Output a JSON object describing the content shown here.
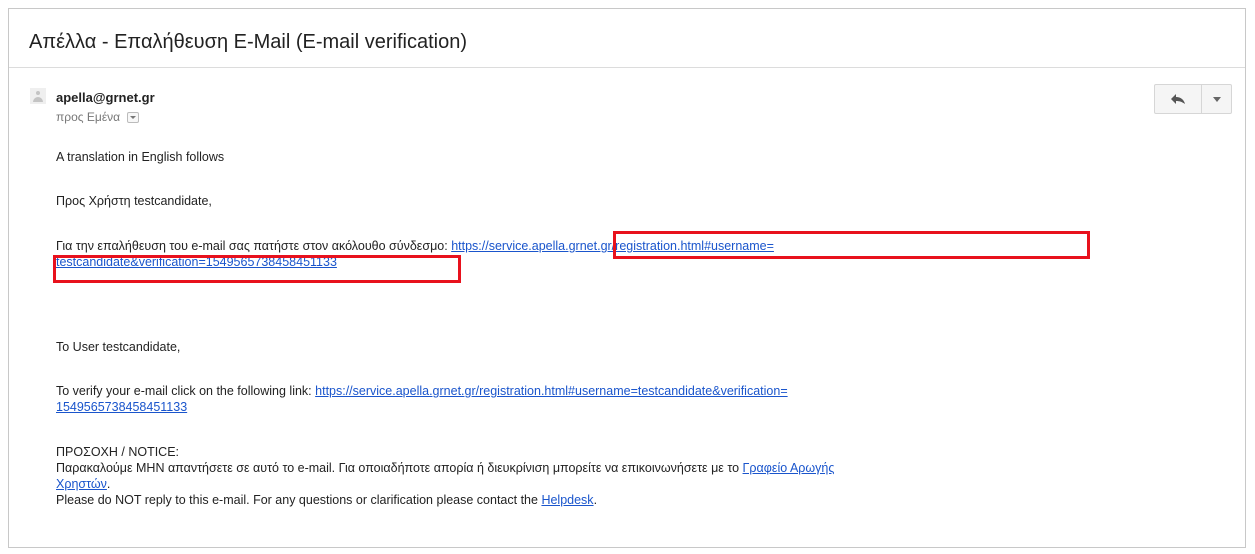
{
  "email": {
    "subject": "Απέλλα - Επαλήθευση E-Mail (E-mail verification)",
    "sender": "apella@grnet.gr",
    "to_line": "προς Εμένα",
    "icons": {
      "avatar": "person-icon",
      "reply": "reply-arrow-icon",
      "more": "chevron-down-icon",
      "details": "chevron-down-icon"
    },
    "body": {
      "intro": "A translation in English follows",
      "greeting_gr": "Προς Χρήστη testcandidate,",
      "verify_gr_text": "Για την επαλήθευση του e-mail σας πατήστε στον ακόλουθο σύνδεσμο:",
      "verify_gr_link_part1": "https://service.apella.grnet.gr/registration.html#username=",
      "verify_gr_link_part2": "testcandidate&verification=1549565738458451133",
      "greeting_en": "To User testcandidate,",
      "verify_en_text": "To verify your e-mail click on the following link:",
      "verify_en_link_part1": "https://service.apella.grnet.gr/registration.html#username=testcandidate&verification=",
      "verify_en_link_part2": "1549565738458451133",
      "notice_title": "ΠΡΟΣΟΧΗ / NOTICE:",
      "notice_gr_text": "Παρακαλούμε ΜΗΝ απαντήσετε σε αυτό το e-mail. Για οποιαδήποτε απορία ή διευκρίνιση μπορείτε να επικοινωνήσετε με το",
      "notice_gr_link_part1": "Γραφείο Αρωγής",
      "notice_gr_link_part2": "Χρηστών",
      "notice_gr_end": ".",
      "notice_en_text": "Please do NOT reply to this e-mail. For any questions or clarification please contact the",
      "notice_en_link": "Helpdesk",
      "notice_en_end": "."
    },
    "highlight_color": "#e8111d",
    "link_color": "#1a55cc"
  }
}
